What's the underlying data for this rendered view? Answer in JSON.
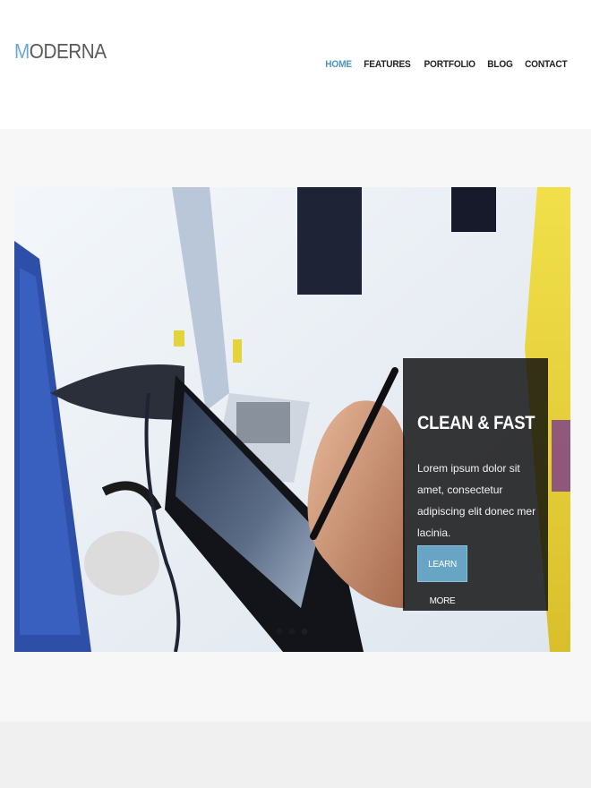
{
  "header": {
    "logo_first": "M",
    "logo_rest": "ODERNA",
    "nav": [
      "HOME",
      "FEATURES",
      "PORTFOLIO",
      "BLOG",
      "CONTACT"
    ],
    "active_nav": "HOME"
  },
  "slider": {
    "caption_title": "CLEAN & FAST",
    "caption_text": "Lorem ipsum dolor sit amet, consectetur adipiscing elit donec mer lacinia.",
    "button_label": "LEARN MORE"
  },
  "colors": {
    "accent": "#68a4c4",
    "nav_active": "#4a95c3",
    "caption_bg": "#0c0c0c"
  }
}
